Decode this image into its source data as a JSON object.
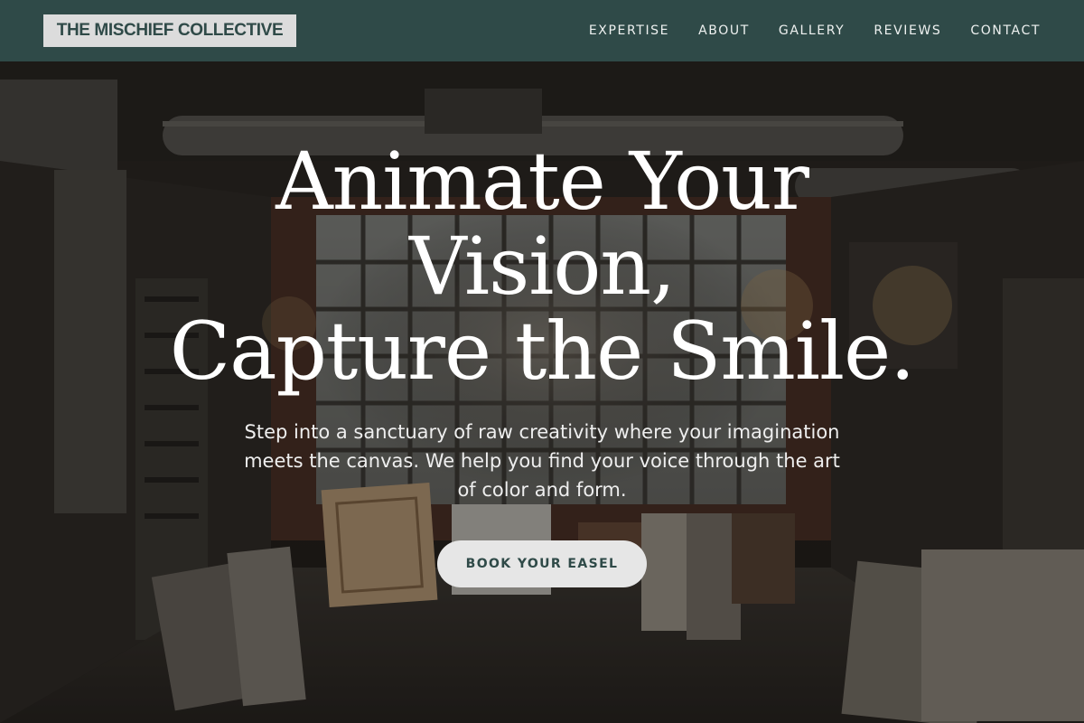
{
  "header": {
    "brand": "THE MISCHIEF COLLECTIVE",
    "nav": [
      {
        "label": "EXPERTISE"
      },
      {
        "label": "ABOUT"
      },
      {
        "label": "GALLERY"
      },
      {
        "label": "REVIEWS"
      },
      {
        "label": "CONTACT"
      }
    ]
  },
  "hero": {
    "headline": {
      "line1": "Animate Your",
      "line2": "Vision,",
      "line3": "Capture the Smile."
    },
    "subtext": "Step into a sanctuary of raw creativity where your imagination meets the canvas. We help you find your voice through the art of color and form.",
    "cta_label": "BOOK YOUR EASEL"
  },
  "colors": {
    "header_bg": "#2f4a48",
    "brand_bg": "#dcdcdc",
    "accent": "#2f4a48",
    "cta_bg": "#e6e6e6",
    "hero_text": "#ffffff"
  },
  "icons": {
    "hero_image": "art-studio-interior-photo"
  }
}
